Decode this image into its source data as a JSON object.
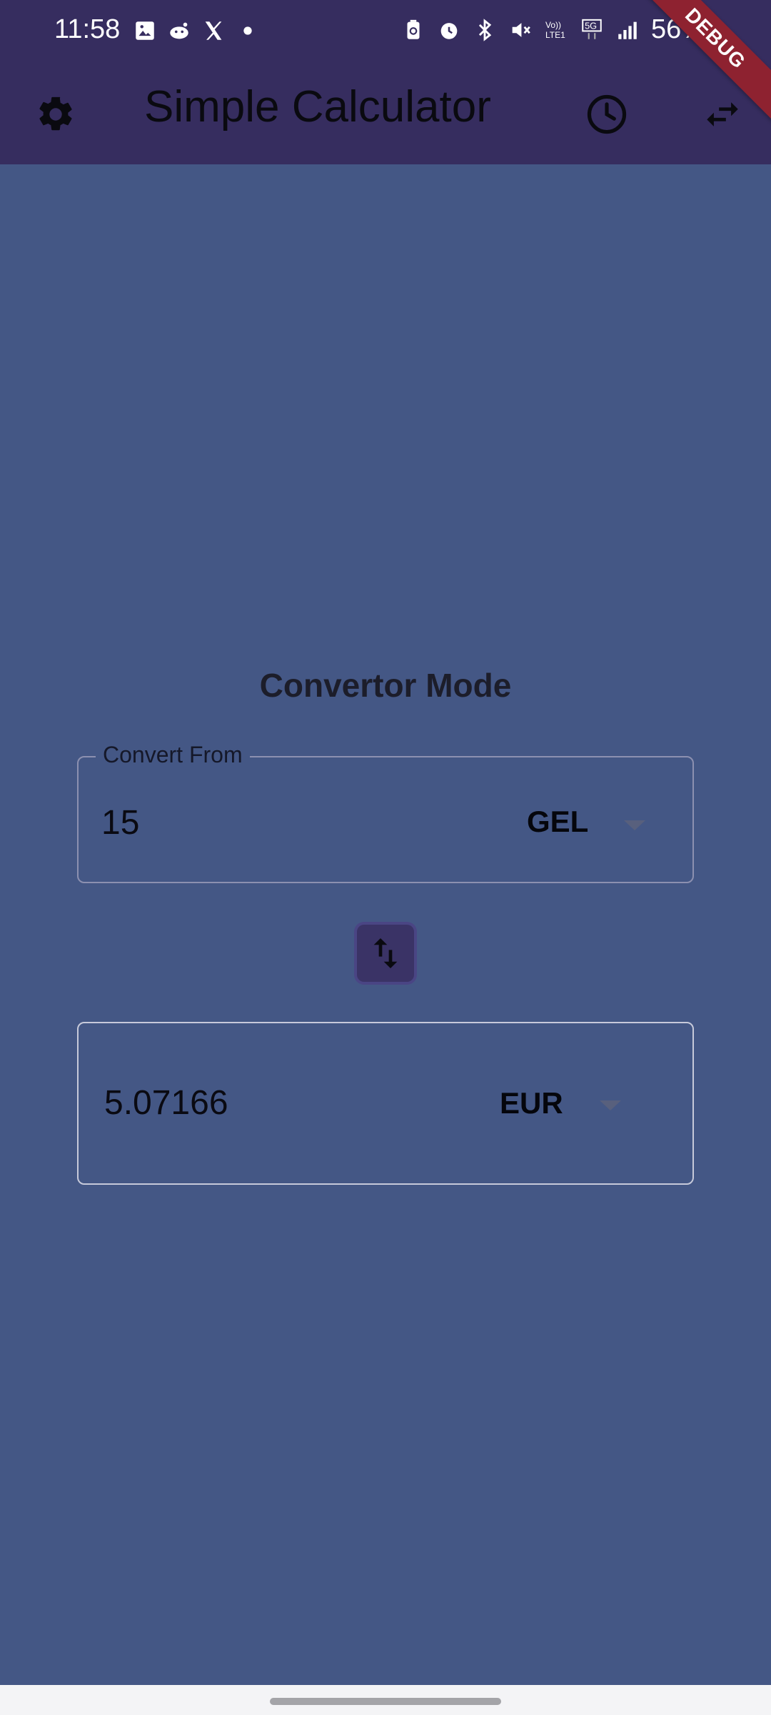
{
  "status_bar": {
    "time": "11:58",
    "battery": "56%",
    "left_icons": [
      "gallery-icon",
      "reddit-icon",
      "x-icon",
      "dot-icon"
    ],
    "right_icons": [
      "battery-saver-icon",
      "alarm-icon",
      "bluetooth-icon",
      "mute-icon",
      "volte-icon",
      "5g-icon",
      "signal-icon"
    ],
    "volte_text": "Vo))\nLTE1",
    "network_text": "5G"
  },
  "app_bar": {
    "title": "Simple Calculator",
    "settings_icon": "gear-icon",
    "history_icon": "clock-icon",
    "mode_icon": "swap-arrows-icon"
  },
  "debug_banner": "DEBUG",
  "converter": {
    "title": "Convertor Mode",
    "from": {
      "label": "Convert From",
      "value": "15",
      "currency": "GEL"
    },
    "to": {
      "value": "5.07166",
      "currency": "EUR"
    },
    "swap_icon": "swap-vertical-icon"
  },
  "colors": {
    "background": "#445785",
    "app_bar": "#362d5f",
    "debug": "#8e2230"
  }
}
